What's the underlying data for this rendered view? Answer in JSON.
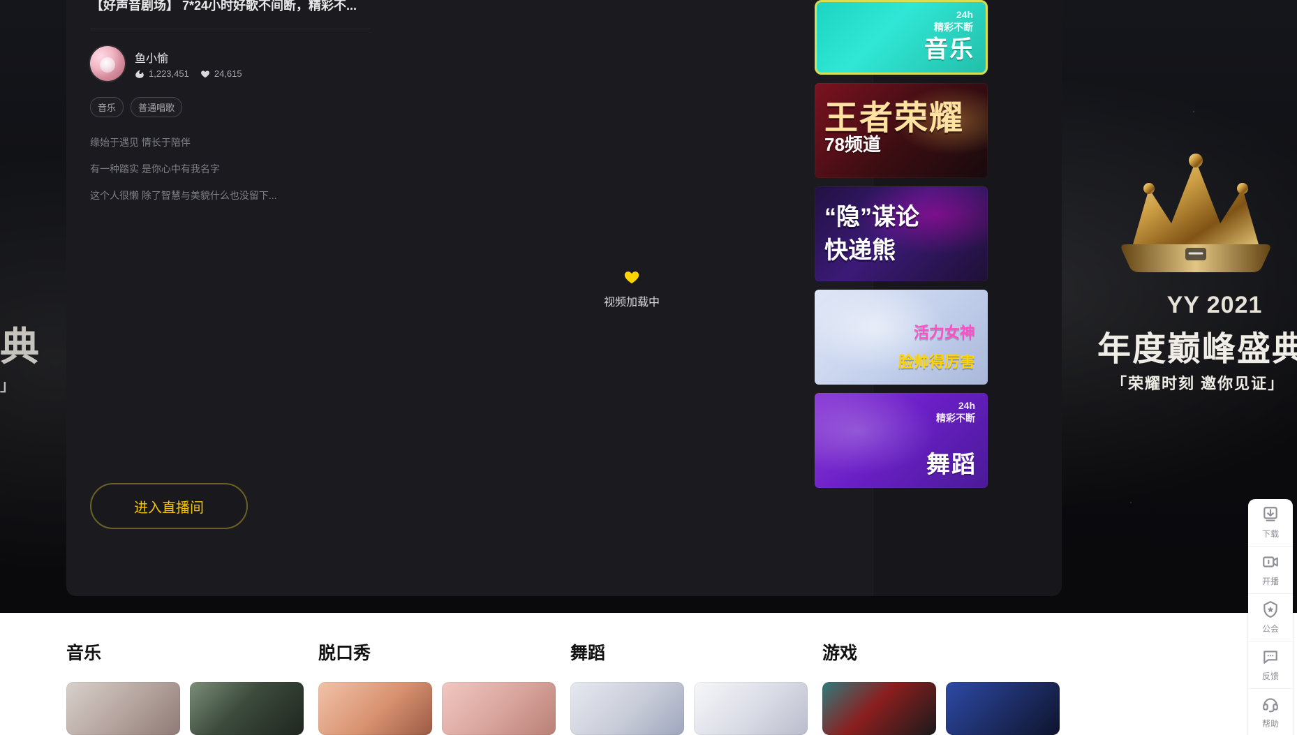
{
  "hero": {
    "left_text": "典",
    "left_bracket": "」",
    "right": {
      "year": "YY 2021",
      "title": "年度巅峰盛典",
      "subtitle": "「荣耀时刻 邀你见证」"
    }
  },
  "room": {
    "title": "【好声音剧场】 7*24小时好歌不间断，精彩不...",
    "anchor": {
      "name": "鱼小愉",
      "fire_count": "1,223,451",
      "heart_count": "24,615"
    },
    "tags": [
      "音乐",
      "普通唱歌"
    ],
    "bio_lines": [
      "缘始于遇见 情长于陪伴",
      "有一种踏实 是你心中有我名字",
      "这个人很懒 除了智慧与美貌什么也没留下..."
    ],
    "loading_text": "视频加载中",
    "enter_button": "进入直播间"
  },
  "right_thumbs": [
    {
      "type": "music",
      "label": "音乐",
      "sub": "24h\n精彩不断",
      "accent": "#d8dd54"
    },
    {
      "type": "game",
      "title": "王者荣耀",
      "subtitle": "78频道"
    },
    {
      "type": "show",
      "title_line1": "“隐”谋论",
      "title_line2": "快递熊"
    },
    {
      "type": "girl",
      "pink": "活力女神",
      "yellow": "脸帅得厉害"
    },
    {
      "type": "dance",
      "label": "舞蹈",
      "sub": "24h\n精彩不断"
    }
  ],
  "sections": {
    "music": "音乐",
    "talk": "脱口秀",
    "dance": "舞蹈",
    "game": "游戏"
  },
  "floating_toolbar": [
    {
      "icon": "download-icon",
      "label": "下载"
    },
    {
      "icon": "video-icon",
      "label": "开播"
    },
    {
      "icon": "shield-icon",
      "label": "公会"
    },
    {
      "icon": "feedback-icon",
      "label": "反馈"
    },
    {
      "icon": "headset-icon",
      "label": "帮助"
    }
  ]
}
